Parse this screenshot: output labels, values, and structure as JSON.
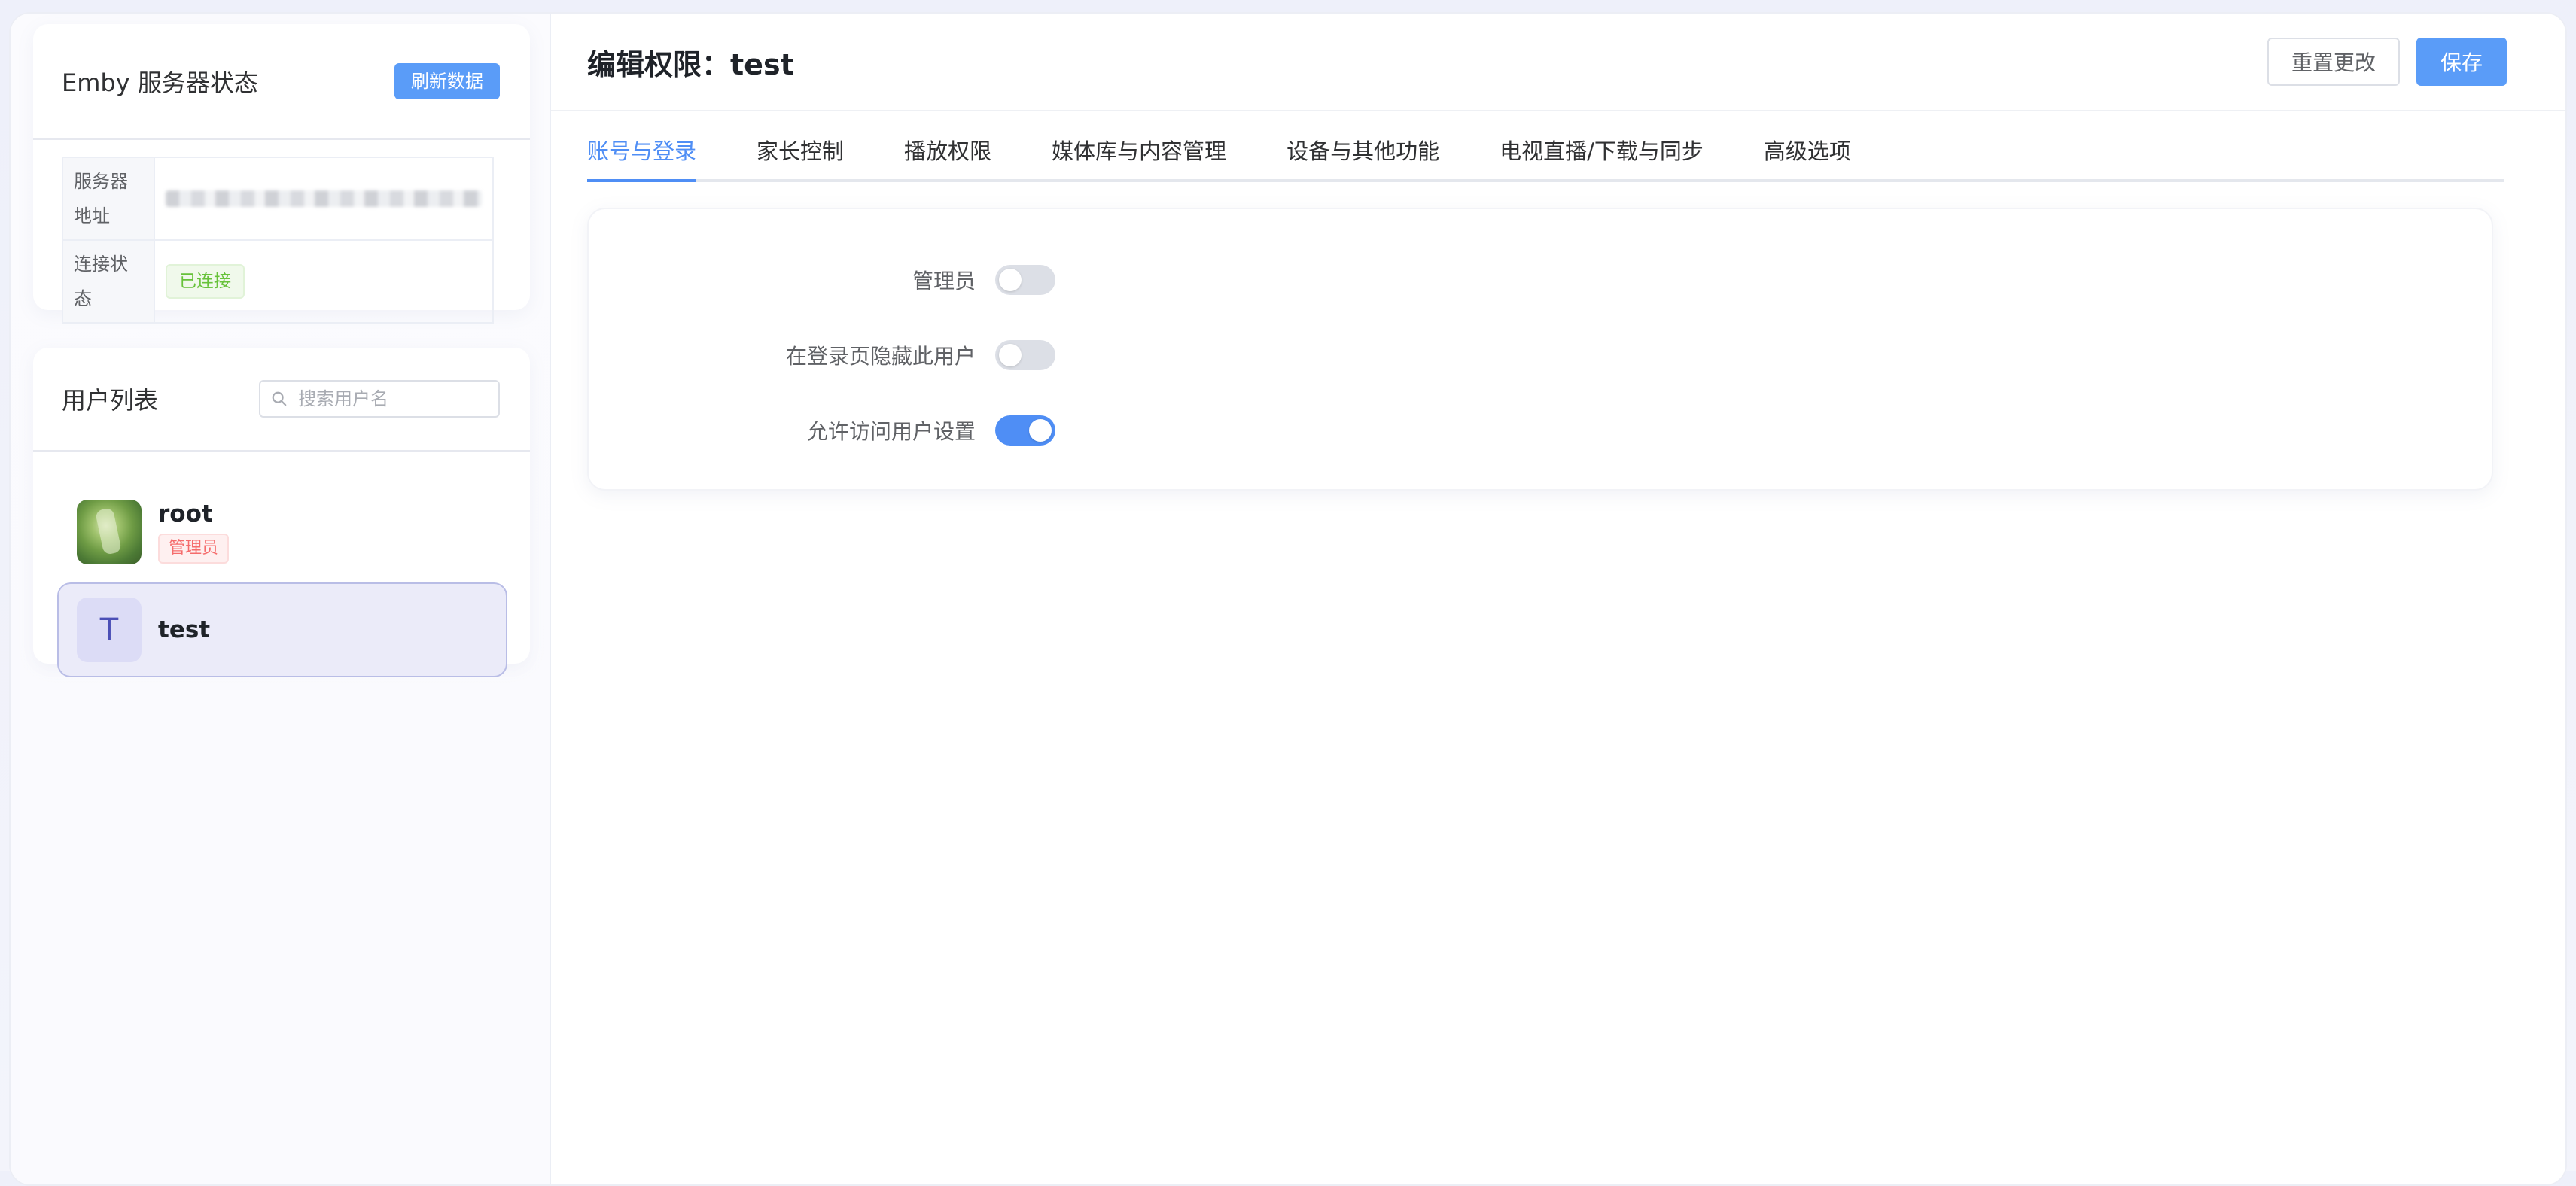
{
  "server": {
    "title": "Emby 服务器状态",
    "refresh_label": "刷新数据",
    "address_label": "服务器地址",
    "status_label": "连接状态",
    "status_value": "已连接"
  },
  "users": {
    "title": "用户列表",
    "search_placeholder": "搜索用户名",
    "items": [
      {
        "name": "root",
        "badge": "管理员",
        "avatar": "photo"
      },
      {
        "name": "test",
        "avatar_letter": "T",
        "selected": true
      }
    ]
  },
  "editor": {
    "title_prefix": "编辑权限：",
    "title_user": "test",
    "reset_label": "重置更改",
    "save_label": "保存",
    "tabs": [
      "账号与登录",
      "家长控制",
      "播放权限",
      "媒体库与内容管理",
      "设备与其他功能",
      "电视直播/下载与同步",
      "高级选项"
    ],
    "active_tab": 0,
    "fields": [
      {
        "label": "管理员",
        "on": false
      },
      {
        "label": "在登录页隐藏此用户",
        "on": false
      },
      {
        "label": "允许访问用户设置",
        "on": true
      }
    ]
  },
  "colors": {
    "primary": "#5a9cf8",
    "success": "#67c23a",
    "danger": "#f56c6c",
    "selected_bg": "#ebebf9"
  }
}
